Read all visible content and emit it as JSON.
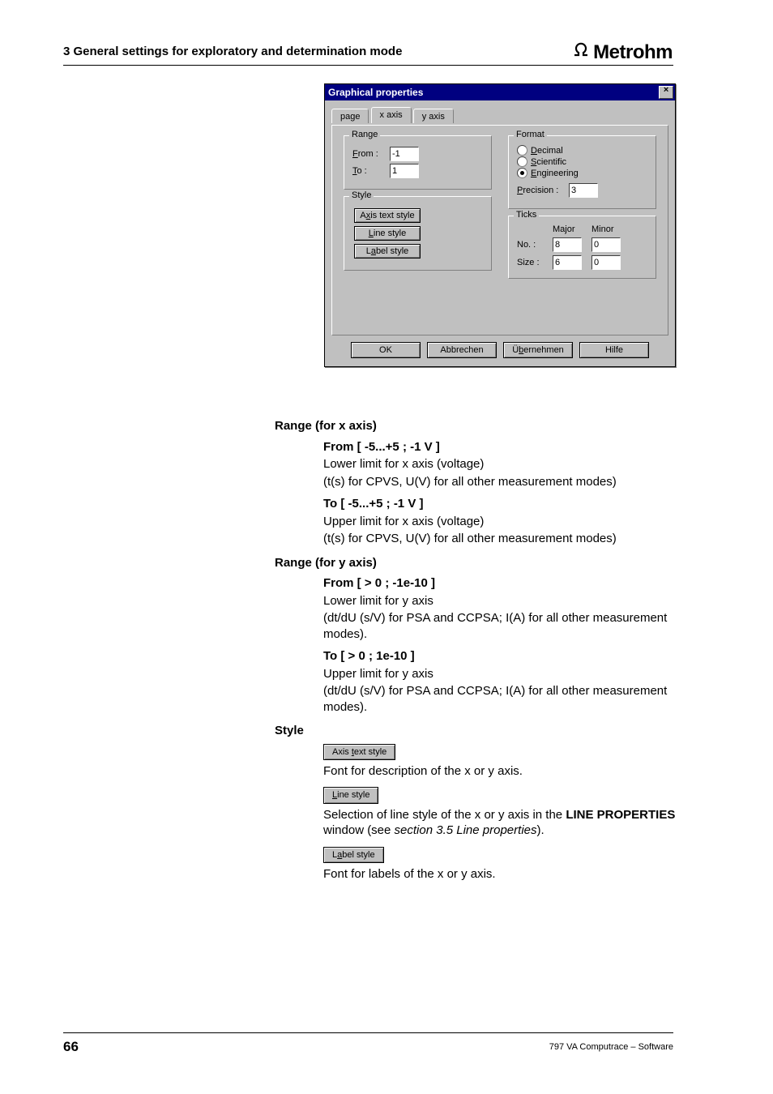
{
  "header": {
    "section": "3  General settings for exploratory and determination mode",
    "brand": "Metrohm"
  },
  "dialog": {
    "title": "Graphical properties",
    "tabs": {
      "page": "page",
      "x": "x axis",
      "y": "y axis"
    },
    "range": {
      "legend": "Range",
      "from_label": "From :",
      "from_value": "-1",
      "to_label": "To :",
      "to_value": "1"
    },
    "style": {
      "legend": "Style",
      "axis_text": "Axis text style",
      "line": "Line style",
      "label": "Label style"
    },
    "format": {
      "legend": "Format",
      "decimal": "Decimal",
      "scientific": "Scientific",
      "engineering": "Engineering",
      "precision_label": "Precision :",
      "precision_value": "3"
    },
    "ticks": {
      "legend": "Ticks",
      "major": "Major",
      "minor": "Minor",
      "no_label": "No. :",
      "no_major": "8",
      "no_minor": "0",
      "size_label": "Size :",
      "size_major": "6",
      "size_minor": "0"
    },
    "buttons": {
      "ok": "OK",
      "cancel": "Abbrechen",
      "apply": "Übernehmen",
      "help": "Hilfe"
    }
  },
  "body": {
    "range_x_h": "Range (for x axis)",
    "from_x_h": "From   [ -5...+5 ; -1 V ]",
    "from_x_1": "Lower limit for x axis (voltage)",
    "from_x_2": "(t(s) for CPVS, U(V) for all other measurement modes)",
    "to_x_h": "To   [ -5...+5  ; -1 V ]",
    "to_x_1": "Upper limit for x axis (voltage)",
    "to_x_2": "(t(s) for CPVS, U(V) for all other measurement modes)",
    "range_y_h": "Range (for y axis)",
    "from_y_h": "From   [ > 0 ; -1e-10 ]",
    "from_y_1": "Lower limit for y axis",
    "from_y_2": "(dt/dU (s/V) for PSA and CCPSA; I(A) for all other measurement modes).",
    "to_y_h": "To   [ > 0 ; 1e-10 ]",
    "to_y_1": "Upper limit for y axis",
    "to_y_2": "(dt/dU (s/V) for PSA and CCPSA; I(A) for all other measurement modes).",
    "style_h": "Style",
    "btn_axis_text": "Axis text style",
    "axis_text_desc": "Font for description of the x or y axis.",
    "btn_line": "Line style",
    "line_desc_1": "Selection of line style of the x or y axis in the ",
    "line_desc_bold": "LINE PROPERTIES",
    "line_desc_2": " window (see ",
    "line_desc_ital": "section 3.5 Line properties",
    "line_desc_3": ").",
    "btn_label": "Label style",
    "label_desc": "Font for labels of the x or y axis."
  },
  "footer": {
    "page": "66",
    "right": "797 VA Computrace – Software"
  }
}
